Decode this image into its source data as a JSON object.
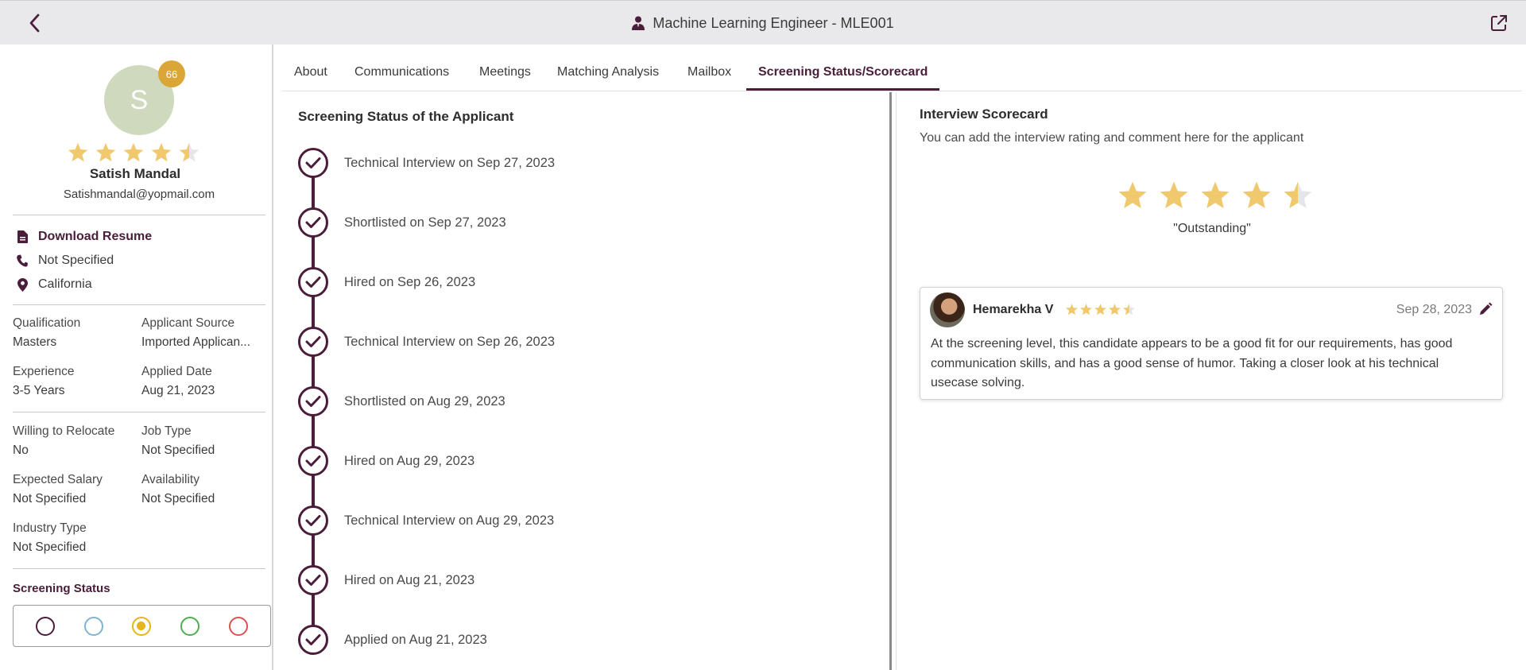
{
  "header": {
    "title": "Machine Learning Engineer - MLE001"
  },
  "candidate": {
    "initial": "S",
    "score": "66",
    "rating": 4.5,
    "name": "Satish Mandal",
    "email": "Satishmandal@yopmail.com",
    "download_resume": "Download Resume",
    "phone": "Not Specified",
    "location": "California",
    "fields": {
      "qualification_label": "Qualification",
      "qualification_value": "Masters",
      "source_label": "Applicant Source",
      "source_value": "Imported Applican...",
      "experience_label": "Experience",
      "experience_value": "3-5 Years",
      "applied_label": "Applied Date",
      "applied_value": "Aug 21, 2023",
      "relocate_label": "Willing to Relocate",
      "relocate_value": "No",
      "jobtype_label": "Job Type",
      "jobtype_value": "Not Specified",
      "salary_label": "Expected Salary",
      "salary_value": "Not Specified",
      "availability_label": "Availability",
      "availability_value": "Not Specified",
      "industry_label": "Industry Type",
      "industry_value": "Not Specified"
    },
    "screening_status_title": "Screening Status",
    "status_colors": [
      "#4a1d3a",
      "#7fb4cf",
      "#e4b51d",
      "#4caf50",
      "#d9534f"
    ],
    "status_selected": 2
  },
  "tabs": [
    {
      "label": "About"
    },
    {
      "label": "Communications"
    },
    {
      "label": "Meetings"
    },
    {
      "label": "Matching Analysis"
    },
    {
      "label": "Mailbox"
    },
    {
      "label": "Screening Status/Scorecard"
    }
  ],
  "active_tab": 5,
  "timeline": {
    "title": "Screening Status of the Applicant",
    "items": [
      "Technical Interview on Sep 27, 2023",
      "Shortlisted on Sep 27, 2023",
      "Hired on Sep 26, 2023",
      "Technical Interview on Sep 26, 2023",
      "Shortlisted on Aug 29, 2023",
      "Hired on Aug 29, 2023",
      "Technical Interview on Aug 29, 2023",
      "Hired on Aug 21, 2023",
      "Applied on Aug 21, 2023"
    ]
  },
  "scorecard": {
    "title": "Interview Scorecard",
    "description": "You can add the interview rating and comment here for the applicant",
    "rating": 4.5,
    "rating_label": "\"Outstanding\"",
    "review": {
      "reviewer": "Hemarekha V",
      "rating": 4.5,
      "date": "Sep 28, 2023",
      "comment": "At the screening level, this candidate appears to be a good fit for our requirements, has good communication skills, and has a good sense of humor. Taking a closer look at his technical usecase solving."
    }
  },
  "colors": {
    "accent": "#4a1d3a",
    "star": "#f0c96e",
    "star_empty": "#e6e6e6",
    "badge": "#d9a637"
  }
}
